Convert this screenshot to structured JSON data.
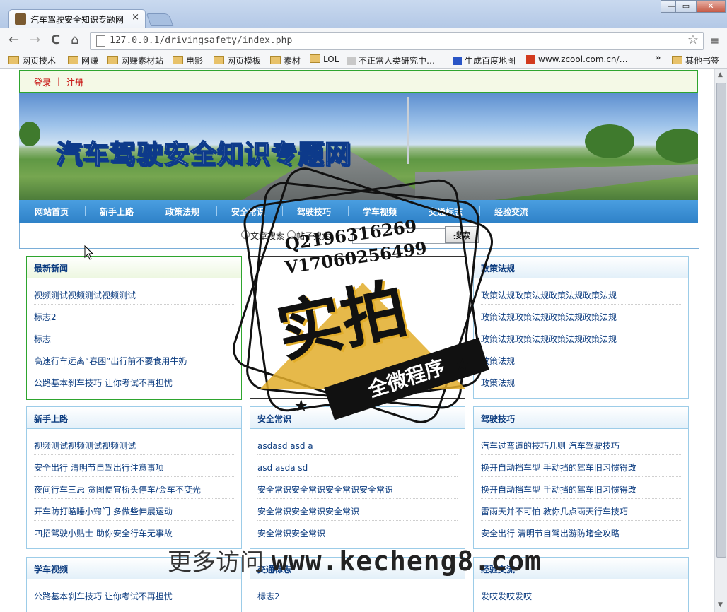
{
  "browser": {
    "tab_title": "汽车驾驶安全知识专题网",
    "tab_close": "×",
    "url": "127.0.0.1/drivingsafety/index.php",
    "win_min": "—",
    "win_max": "▭",
    "win_close": "✕",
    "back": "←",
    "forward": "→",
    "reload": "C",
    "home": "⌂",
    "star": "☆",
    "menu": "≡",
    "bookmarks": [
      {
        "label": "网页技术",
        "icon": "folder-icon"
      },
      {
        "label": "网赚",
        "icon": "folder-icon"
      },
      {
        "label": "网赚素材站",
        "icon": "folder-icon"
      },
      {
        "label": "电影",
        "icon": "folder-icon"
      },
      {
        "label": "网页模板",
        "icon": "folder-icon"
      },
      {
        "label": "素材",
        "icon": "folder-icon"
      },
      {
        "label": "LOL",
        "icon": "folder-icon"
      },
      {
        "label": "不正常人类研究中…",
        "icon": "site-icon"
      },
      {
        "label": "生成百度地图",
        "icon": "baidu-icon"
      },
      {
        "label": "www.zcool.com.cn/…",
        "icon": "zcool-icon"
      }
    ],
    "more": "»",
    "other_bookmarks": "其他书签"
  },
  "site": {
    "login": "登录",
    "sep": "|",
    "register": "注册",
    "banner_title": "汽车驾驶安全知识专题网",
    "nav": [
      "网站首页",
      "新手上路",
      "政策法规",
      "安全常识",
      "驾驶技巧",
      "学车视频",
      "交通标志",
      "经验交流"
    ],
    "search": {
      "opt1": "文章搜索",
      "opt2": "帖子搜索",
      "button": "搜索",
      "query": ""
    },
    "boxes": [
      {
        "title": "最新新闻",
        "items": [
          "视频测试视频测试视频测试",
          "标志2",
          "标志一",
          "高速行车远离“春困”出行前不要食用牛奶",
          "公路基本刹车技巧 让你考试不再担忧"
        ]
      },
      {
        "title": "",
        "items": []
      },
      {
        "title": "政策法规",
        "items": [
          "政策法规政策法规政策法规政策法规",
          "政策法规政策法规政策法规政策法规",
          "政策法规政策法规政策法规政策法规",
          "政策法规",
          "政策法规"
        ]
      },
      {
        "title": "新手上路",
        "items": [
          "视频测试视频测试视频测试",
          "安全出行 清明节自驾出行注意事项",
          "夜间行车三忌 贪图便宜桥头停车/会车不变光",
          "开车防打瞌睡小窍门 多做些伸展运动",
          "四招驾驶小贴士 助你安全行车无事故"
        ]
      },
      {
        "title": "安全常识",
        "items": [
          "asdasd asd a",
          "asd asda sd",
          "安全常识安全常识安全常识安全常识",
          "安全常识安全常识安全常识",
          "安全常识安全常识"
        ]
      },
      {
        "title": "驾驶技巧",
        "items": [
          "汽车过弯道的技巧几则 汽车驾驶技巧",
          "换开自动挡车型 手动挡的驾车旧习惯得改",
          "换开自动挡车型 手动挡的驾车旧习惯得改",
          "雷雨天并不可怕 教你几点雨天行车技巧",
          "安全出行 清明节自驾出游防堵全攻略"
        ]
      },
      {
        "title": "学车视频",
        "items": [
          "公路基本刹车技巧 让你考试不再担忧"
        ]
      },
      {
        "title": "交通标志",
        "items": [
          "标志2"
        ]
      },
      {
        "title": "经验交流",
        "items": [
          "发哎发哎发哎"
        ]
      }
    ]
  },
  "watermark": {
    "line1": "Q2196316269",
    "line2": "V17060256499",
    "big": "实拍",
    "ribbon": "全微程序",
    "footer_cn": "更多访问",
    "footer_url": "www.kecheng8.com"
  }
}
